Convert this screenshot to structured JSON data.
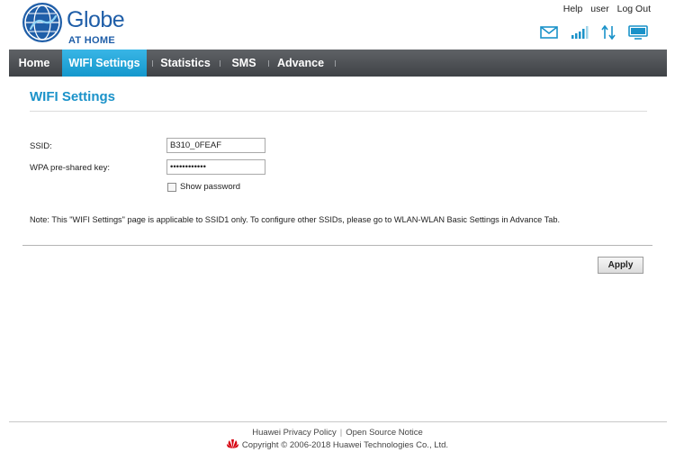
{
  "brand": {
    "name": "Globe",
    "tagline": "AT HOME",
    "colors": {
      "primary": "#1f5ea8",
      "accent": "#1a92c9",
      "nav_active": "#1fa7dc"
    }
  },
  "top_links": {
    "help": "Help",
    "user": "user",
    "logout": "Log Out"
  },
  "status_icons": [
    "envelope-icon",
    "signal-strength-icon",
    "data-transfer-icon",
    "monitor-icon"
  ],
  "nav": {
    "items": [
      {
        "label": "Home",
        "active": false
      },
      {
        "label": "WIFI Settings",
        "active": true
      },
      {
        "label": "Statistics",
        "active": false
      },
      {
        "label": "SMS",
        "active": false
      },
      {
        "label": "Advance",
        "active": false
      }
    ]
  },
  "page": {
    "title": "WIFI Settings",
    "ssid_label": "SSID:",
    "ssid_value": "B310_0FEAF",
    "wpa_label": "WPA pre-shared key:",
    "wpa_value": "••••••••••••",
    "show_password_label": "Show password",
    "note": "Note: This \"WIFI Settings\" page is applicable to SSID1 only. To configure other SSIDs, please go to WLAN-WLAN Basic Settings in Advance Tab.",
    "apply_label": "Apply"
  },
  "footer": {
    "privacy": "Huawei Privacy Policy",
    "opensource": "Open Source Notice",
    "separator": "|",
    "copyright": "Copyright © 2006-2018 Huawei Technologies Co., Ltd."
  }
}
